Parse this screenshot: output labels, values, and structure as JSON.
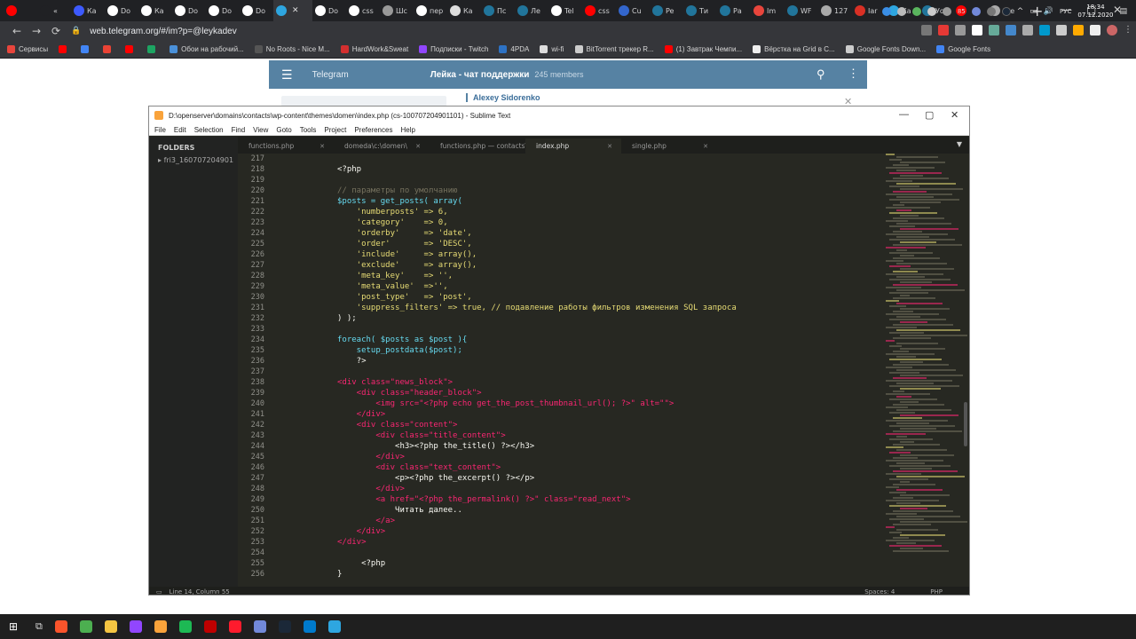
{
  "browser": {
    "tabs": [
      {
        "label": "",
        "color": "#ff0000"
      },
      {
        "label": "«",
        "color": "#202124"
      },
      {
        "label": "Кa",
        "color": "#3d5afe"
      },
      {
        "label": "Do",
        "color": "#ffffff"
      },
      {
        "label": "Ка",
        "color": "#ffffff"
      },
      {
        "label": "Do",
        "color": "#ffffff"
      },
      {
        "label": "Do",
        "color": "#ffffff"
      },
      {
        "label": "Do",
        "color": "#ffffff"
      },
      {
        "label": "",
        "color": "#2ea6e0",
        "active": true
      },
      {
        "label": "Do",
        "color": "#ffffff"
      },
      {
        "label": "css",
        "color": "#ffffff"
      },
      {
        "label": "Шс",
        "color": "#999999"
      },
      {
        "label": "пер",
        "color": "#ffffff"
      },
      {
        "label": "Ка",
        "color": "#dddddd"
      },
      {
        "label": "Пс",
        "color": "#21759b"
      },
      {
        "label": "Ле",
        "color": "#21759b"
      },
      {
        "label": "Tel",
        "color": "#ffffff"
      },
      {
        "label": "css",
        "color": "#ff0000"
      },
      {
        "label": "Cu",
        "color": "#3366cc"
      },
      {
        "label": "Pe",
        "color": "#21759b"
      },
      {
        "label": "Ти",
        "color": "#21759b"
      },
      {
        "label": "Ра",
        "color": "#21759b"
      },
      {
        "label": "Im",
        "color": "#e8453c"
      },
      {
        "label": "WF",
        "color": "#21759b"
      },
      {
        "label": "127",
        "color": "#aaaaaa"
      },
      {
        "label": "Iar",
        "color": "#d93025"
      },
      {
        "label": "Ка",
        "color": "#2ea6e0"
      },
      {
        "label": "Уст",
        "color": "#21759b"
      },
      {
        "label": "",
        "color": "#ff0000"
      },
      {
        "label": "the",
        "color": "#aaaaaa"
      }
    ],
    "new_tab": "+",
    "url": "web.telegram.org/#/im?p=@leykadev",
    "bookmarks": [
      {
        "label": "Сервисы",
        "color": "#e8453c"
      },
      {
        "label": "",
        "color": "#ff0000"
      },
      {
        "label": "",
        "color": "#4285f4"
      },
      {
        "label": "",
        "color": "#ea4335"
      },
      {
        "label": "",
        "color": "#ff0000"
      },
      {
        "label": "",
        "color": "#1da462"
      },
      {
        "label": "Обои на рабочий...",
        "color": "#4a90d9"
      },
      {
        "label": "No Roots - Nice M...",
        "color": "#555555"
      },
      {
        "label": "HardWork&Sweat",
        "color": "#d32f2f"
      },
      {
        "label": "Подписки - Twitch",
        "color": "#9146ff"
      },
      {
        "label": "4PDA",
        "color": "#2d72c4"
      },
      {
        "label": "wi-fi",
        "color": "#dddddd"
      },
      {
        "label": "BitTorrent трекер R...",
        "color": "#cccccc"
      },
      {
        "label": "(1) Завтрак Чемпи...",
        "color": "#ff0000"
      },
      {
        "label": "Вёрстка на Grid в C...",
        "color": "#eeeeee"
      },
      {
        "label": "Google Fonts Down...",
        "color": "#cccccc"
      },
      {
        "label": "Google Fonts",
        "color": "#4285f4"
      }
    ]
  },
  "telegram": {
    "app_title": "Telegram",
    "chat_title": "Лейка - чат поддержки",
    "members": "245 members",
    "sender": "Alexey Sidorenko"
  },
  "sublime": {
    "title": "D:\\openserver\\domains\\contacts\\wp-content\\themes\\domen\\index.php (cs-100707204901101) - Sublime Text",
    "menu": [
      "File",
      "Edit",
      "Selection",
      "Find",
      "View",
      "Goto",
      "Tools",
      "Project",
      "Preferences",
      "Help"
    ],
    "sidebar_header": "FOLDERS",
    "folder_item": "fri3_160707204901",
    "tabs": [
      {
        "label": "functions.php",
        "active": false
      },
      {
        "label": "domeda\\c:\\domen\\",
        "active": false
      },
      {
        "label": "functions.php — contacts\\domen\\",
        "active": false
      },
      {
        "label": "index.php",
        "active": true
      },
      {
        "label": "single.php",
        "active": false
      }
    ],
    "line_numbers": [
      "217",
      "218",
      "219",
      "220",
      "221",
      "222",
      "223",
      "224",
      "225",
      "226",
      "227",
      "228",
      "229",
      "230",
      "231",
      "232",
      "233",
      "234",
      "235",
      "236",
      "237",
      "238",
      "239",
      "240",
      "241",
      "242",
      "243",
      "244",
      "245",
      "246",
      "247",
      "248",
      "249",
      "250",
      "251",
      "252",
      "253",
      "254",
      "255",
      "256"
    ],
    "code_lines": [
      "",
      "<?php",
      "",
      "// параметры по умолчанию",
      "$posts = get_posts( array(",
      "    'numberposts' => 6,",
      "    'category'    => 0,",
      "    'orderby'     => 'date',",
      "    'order'       => 'DESC',",
      "    'include'     => array(),",
      "    'exclude'     => array(),",
      "    'meta_key'    => '',",
      "    'meta_value'  =>'',",
      "    'post_type'   => 'post',",
      "    'suppress_filters' => true, // подавление работы фильтров изменения SQL запроса",
      ") );",
      "",
      "foreach( $posts as $post ){",
      "    setup_postdata($post);",
      "    ?>",
      "",
      "<div class=\"news_block\">",
      "    <div class=\"header_block\">",
      "        <img src=\"<?php echo get_the_post_thumbnail_url(); ?>\" alt=\"\">",
      "    </div>",
      "    <div class=\"content\">",
      "        <div class=\"title_content\">",
      "            <h3><?php the_title() ?></h3>",
      "        </div>",
      "        <div class=\"text_content\">",
      "            <p><?php the_excerpt() ?></p>",
      "        </div>",
      "        <a href=\"<?php the_permalink() ?>\" class=\"read_next\">",
      "            Читать далее..",
      "        </a>",
      "    </div>",
      "</div>",
      "",
      "     <?php",
      "}"
    ],
    "status_left": "Line 14, Column 55",
    "status_spaces": "Spaces: 4",
    "status_syntax": "PHP"
  },
  "taskbar": {
    "icons": [
      {
        "name": "brave-icon",
        "color": "#fb542b"
      },
      {
        "name": "chrome-icon",
        "color": "#4caf50"
      },
      {
        "name": "file-explorer-icon",
        "color": "#f4c542"
      },
      {
        "name": "twitch-app-icon",
        "color": "#9146ff"
      },
      {
        "name": "sublime-text-icon",
        "color": "#f9a33b"
      },
      {
        "name": "spotify-icon",
        "color": "#1db954"
      },
      {
        "name": "filezilla-icon",
        "color": "#bf0000"
      },
      {
        "name": "opera-icon",
        "color": "#ff1b2d"
      },
      {
        "name": "discord-icon",
        "color": "#7289da"
      },
      {
        "name": "steam-icon",
        "color": "#1b2838"
      },
      {
        "name": "vscode-icon",
        "color": "#007acc"
      },
      {
        "name": "telegram-icon",
        "color": "#2ea6e0"
      }
    ],
    "language": "РУС",
    "time": "18:34",
    "date": "07.12.2020",
    "tray_volume_label": "85"
  }
}
